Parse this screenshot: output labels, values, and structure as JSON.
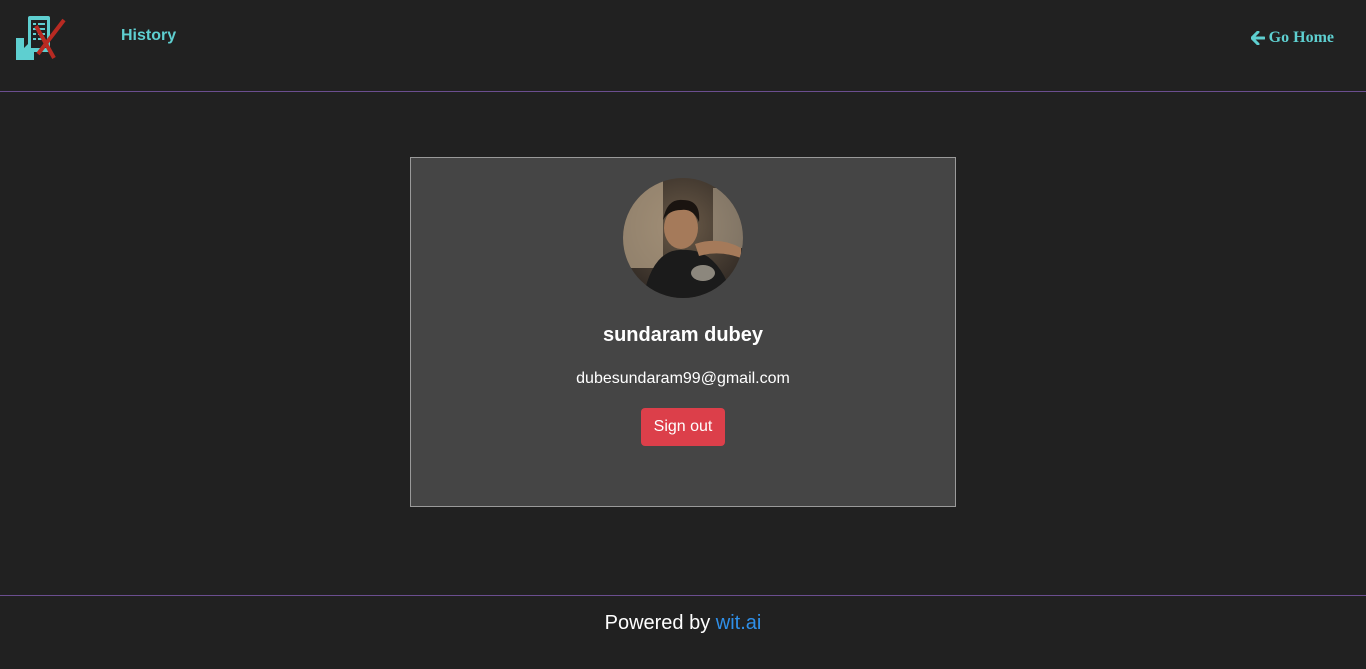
{
  "nav": {
    "history_label": "History",
    "home_label": "Go Home",
    "home_icon": "arrow-left-icon",
    "logo_icon": "phone-checklist-logo"
  },
  "profile": {
    "name": "sundaram dubey",
    "email": "dubesundaram99@gmail.com",
    "signout_label": "Sign out"
  },
  "footer": {
    "prefix": "Powered by",
    "link_label": "wit.ai"
  },
  "colors": {
    "background": "#212121",
    "card": "#454545",
    "accent_teal": "#5ecfd0",
    "divider": "#6b4e8f",
    "danger": "#dc3f4a",
    "link": "#2f8fe8"
  }
}
